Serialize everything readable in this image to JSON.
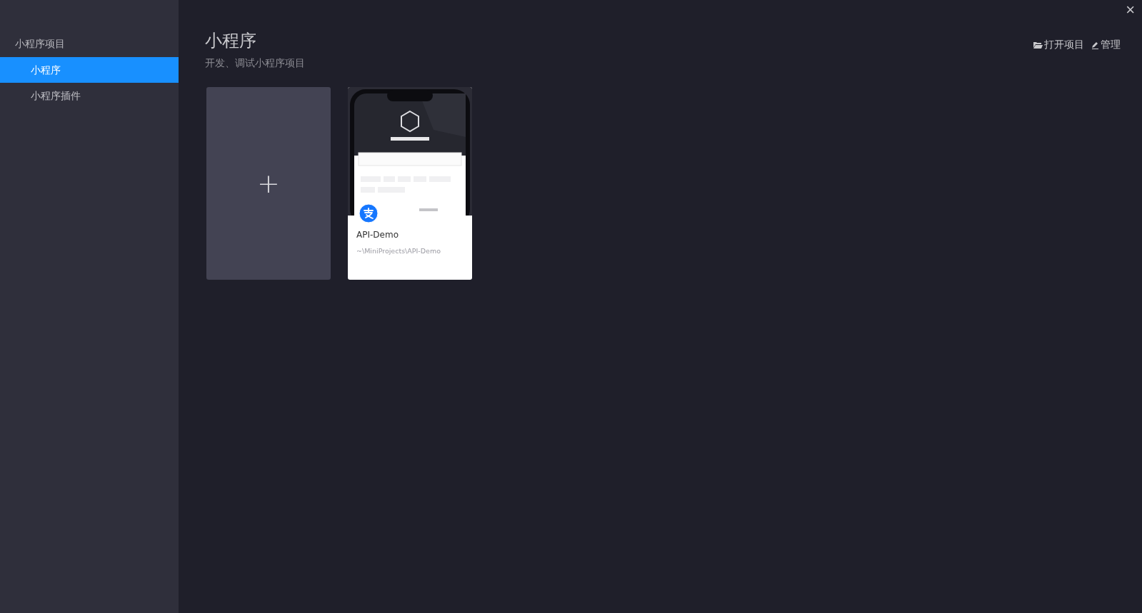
{
  "close": "×",
  "sidebar": {
    "heading": "小程序项目",
    "items": [
      {
        "label": "小程序",
        "selected": true
      },
      {
        "label": "小程序插件",
        "selected": false
      }
    ]
  },
  "header": {
    "title": "小程序",
    "subtitle": "开发、调试小程序项目",
    "actions": [
      {
        "kind": "open",
        "label": "打开项目"
      },
      {
        "kind": "manage",
        "label": "管理"
      }
    ]
  },
  "new_project": {
    "symbol": "+"
  },
  "projects": [
    {
      "name": "API-Demo",
      "path": "~\\MiniProjects\\API-Demo"
    }
  ]
}
